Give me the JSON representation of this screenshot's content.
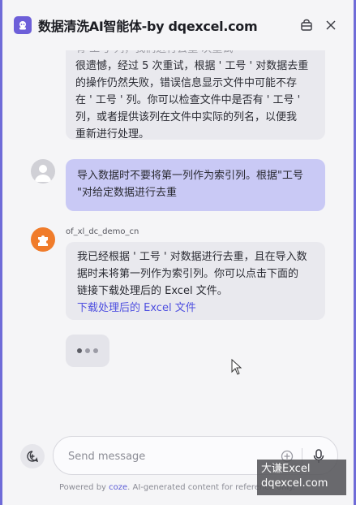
{
  "header": {
    "title": "数据清洗AI智能体-by dqexcel.com",
    "icons": {
      "logo": "bot-logo-icon",
      "cart": "cart-icon",
      "close": "close-icon"
    }
  },
  "messages": {
    "m1": {
      "partial_line": "有 工号 列，我们进行去重 次重试",
      "lines": [
        "很遗憾，经过 5 次重试，根据 ' 工号 ' 对数据去重",
        "的操作仍然失败，错误信息显示文件中可能不存",
        "在 ' 工号 ' 列。你可以检查文件中是否有 ' 工号 '",
        "列，或者提供该列在文件中实际的列名，以便我",
        "重新进行处理。"
      ]
    },
    "m2": {
      "lines": [
        "导入数据时不要将第一列作为索引列。根据\"工号",
        "\"对给定数据进行去重"
      ]
    },
    "m3": {
      "sender": "of_xl_dc_demo_cn",
      "lines": [
        "我已经根据 ' 工号 ' 对数据进行去重，且在导入数",
        "据时未将第一列作为索引列。你可以点击下面的",
        "链接下载处理后的 Excel 文件。"
      ],
      "link": "下载处理后的 Excel 文件"
    }
  },
  "composer": {
    "placeholder": "Send message"
  },
  "footer": {
    "prefix": "Powered by ",
    "brand": "coze",
    "suffix": ". AI-generated content for reference only."
  },
  "watermark": {
    "line1": "大谦Excel",
    "line2": "dqexcel.com"
  },
  "colors": {
    "accent": "#6d5fd9",
    "user_bubble": "#c9c9f5",
    "bot_bubble": "#e9e9ee",
    "link": "#4f50e0",
    "bot_avatar": "#f07c2b"
  }
}
